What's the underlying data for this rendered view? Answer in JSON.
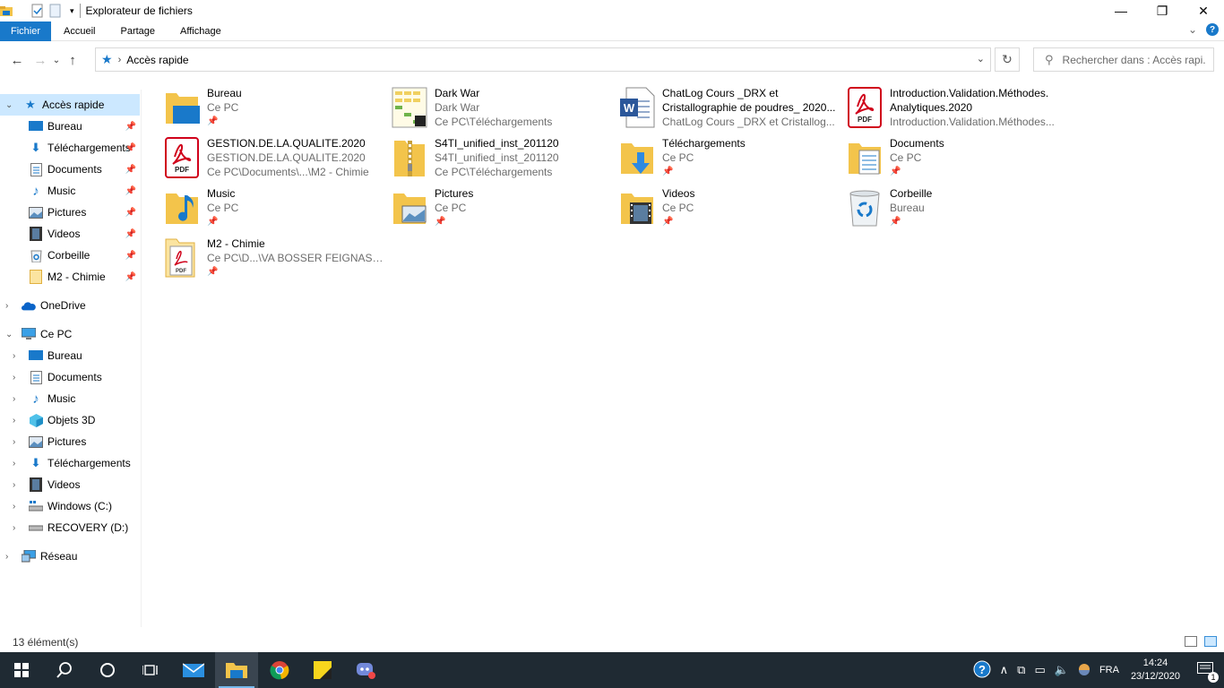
{
  "window": {
    "title": "Explorateur de fichiers"
  },
  "ribbon": {
    "tabs": [
      {
        "label": "Fichier",
        "active": true
      },
      {
        "label": "Accueil"
      },
      {
        "label": "Partage"
      },
      {
        "label": "Affichage"
      }
    ]
  },
  "address": {
    "breadcrumb": "Accès rapide",
    "search_placeholder": "Rechercher dans : Accès rapi..."
  },
  "nav": {
    "items": [
      {
        "label": "Accès rapide",
        "icon": "quick-access-star-icon",
        "pinned": false,
        "selected": true
      },
      {
        "label": "Bureau",
        "icon": "desktop-icon",
        "pinned": true
      },
      {
        "label": "Téléchargements",
        "icon": "download-icon",
        "pinned": true
      },
      {
        "label": "Documents",
        "icon": "documents-icon",
        "pinned": true
      },
      {
        "label": "Music",
        "icon": "music-icon",
        "pinned": true
      },
      {
        "label": "Pictures",
        "icon": "pictures-icon",
        "pinned": true
      },
      {
        "label": "Videos",
        "icon": "videos-icon",
        "pinned": true
      },
      {
        "label": "Corbeille",
        "icon": "recycle-bin-icon",
        "pinned": true
      },
      {
        "label": "M2 - Chimie",
        "icon": "folder-icon",
        "pinned": true
      },
      {
        "label": "OneDrive",
        "icon": "onedrive-icon"
      },
      {
        "label": "Ce PC",
        "icon": "computer-icon"
      },
      {
        "label": "Bureau",
        "icon": "desktop-icon"
      },
      {
        "label": "Documents",
        "icon": "documents-icon"
      },
      {
        "label": "Music",
        "icon": "music-icon"
      },
      {
        "label": "Objets 3D",
        "icon": "objects-3d-icon"
      },
      {
        "label": "Pictures",
        "icon": "pictures-icon"
      },
      {
        "label": "Téléchargements",
        "icon": "download-icon"
      },
      {
        "label": "Videos",
        "icon": "videos-icon"
      },
      {
        "label": "Windows (C:)",
        "icon": "drive-c-icon"
      },
      {
        "label": "RECOVERY (D:)",
        "icon": "drive-d-icon"
      },
      {
        "label": "Réseau",
        "icon": "network-icon"
      }
    ]
  },
  "content": {
    "tiles": [
      {
        "name": "Bureau",
        "sub": "Ce PC",
        "icon": "desktop-folder-icon",
        "pinned": true
      },
      {
        "name": "Dark War",
        "sub": "Dark War",
        "sub2": "Ce PC\\Téléchargements",
        "icon": "spreadsheet-icon"
      },
      {
        "name": "ChatLog Cours _DRX et",
        "name2": "Cristallographie de poudres_ 2020...",
        "sub": "ChatLog Cours _DRX et Cristallog...",
        "icon": "word-document-icon"
      },
      {
        "name": "Introduction.Validation.Méthodes.",
        "name2": "Analytiques.2020",
        "sub": "Introduction.Validation.Méthodes...",
        "icon": "pdf-icon"
      },
      {
        "name": "GESTION.DE.LA.QUALITE.2020",
        "sub": "GESTION.DE.LA.QUALITE.2020",
        "sub2": "Ce PC\\Documents\\...\\M2 - Chimie",
        "icon": "pdf-icon"
      },
      {
        "name": "S4TI_unified_inst_201120",
        "sub": "S4TI_unified_inst_201120",
        "sub2": "Ce PC\\Téléchargements",
        "icon": "zip-folder-icon"
      },
      {
        "name": "Téléchargements",
        "sub": "Ce PC",
        "icon": "downloads-folder-icon",
        "pinned": true
      },
      {
        "name": "Documents",
        "sub": "Ce PC",
        "icon": "documents-folder-icon",
        "pinned": true
      },
      {
        "name": "Music",
        "sub": "Ce PC",
        "icon": "music-folder-icon",
        "pinned": true
      },
      {
        "name": "Pictures",
        "sub": "Ce PC",
        "icon": "pictures-folder-icon",
        "pinned": true
      },
      {
        "name": "Videos",
        "sub": "Ce PC",
        "icon": "videos-folder-icon",
        "pinned": true
      },
      {
        "name": "Corbeille",
        "sub": "Bureau",
        "icon": "recycle-bin-icon",
        "pinned": true
      },
      {
        "name": "M2 - Chimie",
        "sub": "Ce PC\\D...\\VA BOSSER FEIGNASSE !",
        "icon": "pdf-folder-icon",
        "pinned": true
      }
    ]
  },
  "status": {
    "count": "13 élément(s)"
  },
  "taskbar": {
    "language": "FRA",
    "time": "14:24",
    "date": "23/12/2020",
    "notifications": "1"
  },
  "colors": {
    "accent": "#1979ca",
    "selection": "#cce8ff",
    "folder": "#f3c44b",
    "taskbar": "#1f2a33"
  }
}
